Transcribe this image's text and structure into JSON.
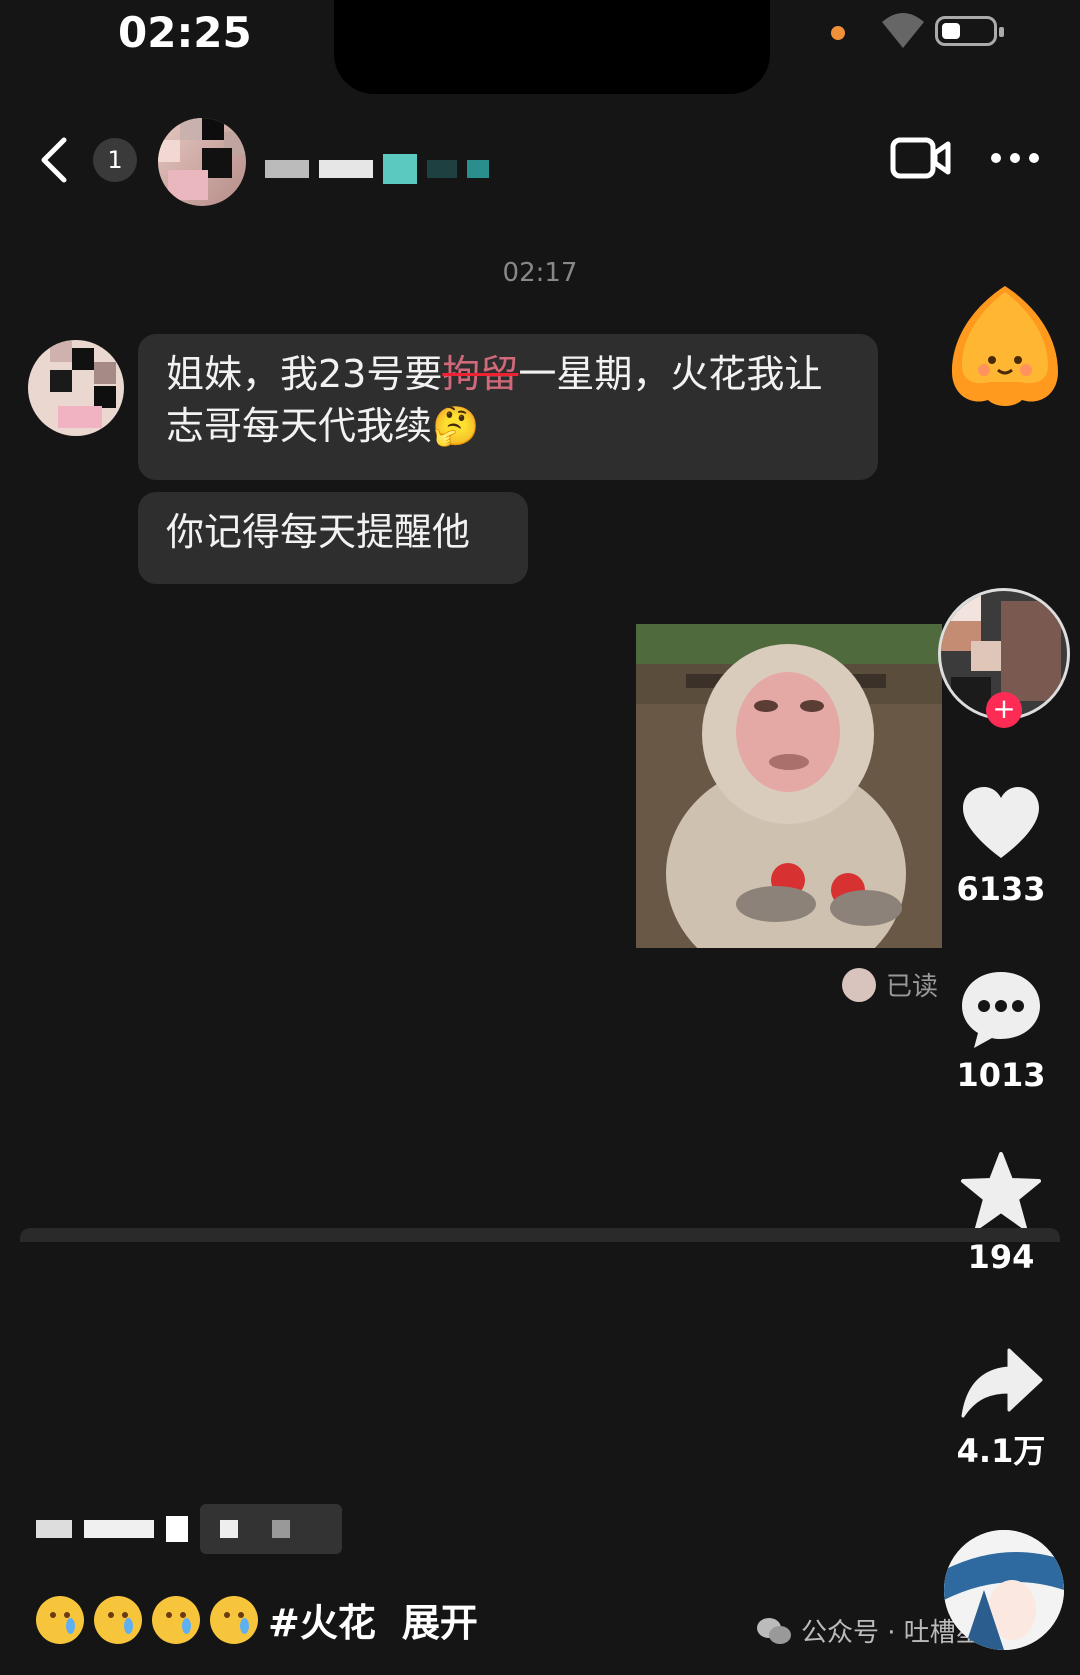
{
  "status_bar": {
    "time": "02:25"
  },
  "header": {
    "unread_badge": "1"
  },
  "chat": {
    "timestamp": "02:17",
    "messages": [
      {
        "from": "other",
        "text_before": "姐妹，我23号要",
        "struck": "拘留",
        "text_after": "一星期，火花我让志哥每天代我续🤔"
      },
      {
        "from": "other",
        "text": "你记得每天提醒他"
      }
    ],
    "read_receipt": "已读"
  },
  "sidebar": {
    "likes": "6133",
    "comments": "1013",
    "favorites": "194",
    "shares": "4.1万"
  },
  "caption": {
    "hashtag": "#火花",
    "expand_label": "展开"
  },
  "watermark": {
    "text": "公众号 · 吐槽星君"
  },
  "colors": {
    "background": "#151515",
    "bubble": "#2e2e2e",
    "follow": "#fe2c55"
  }
}
